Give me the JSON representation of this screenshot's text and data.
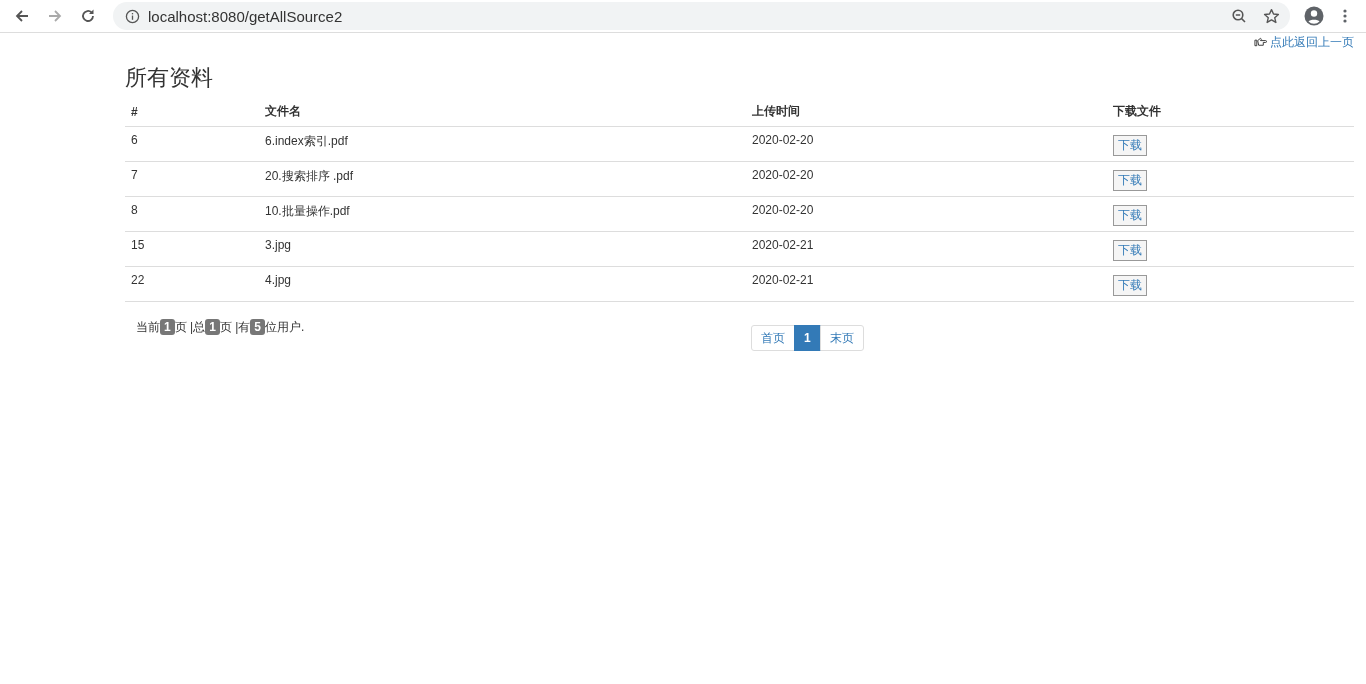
{
  "browser": {
    "back_disabled": false,
    "forward_disabled": true,
    "url": "localhost:8080/getAllSource2"
  },
  "back_link": "点此返回上一页",
  "title": "所有资料",
  "table": {
    "columns": [
      "#",
      "文件名",
      "上传时间",
      "下载文件"
    ],
    "rows": [
      {
        "id": "6",
        "name": "6.index索引.pdf",
        "time": "2020-02-20",
        "action": "下载"
      },
      {
        "id": "7",
        "name": "20.搜索排序 .pdf",
        "time": "2020-02-20",
        "action": "下载"
      },
      {
        "id": "8",
        "name": "10.批量操作.pdf",
        "time": "2020-02-20",
        "action": "下载"
      },
      {
        "id": "15",
        "name": "3.jpg",
        "time": "2020-02-21",
        "action": "下载"
      },
      {
        "id": "22",
        "name": "4.jpg",
        "time": "2020-02-21",
        "action": "下载"
      }
    ]
  },
  "status": [
    {
      "kind": "text",
      "text": "当前"
    },
    {
      "kind": "badge",
      "text": "1"
    },
    {
      "kind": "text",
      "text": "页 |总"
    },
    {
      "kind": "badge",
      "text": "1"
    },
    {
      "kind": "text",
      "text": "页 |有"
    },
    {
      "kind": "badge",
      "text": "5"
    },
    {
      "kind": "text",
      "text": "位用户."
    }
  ],
  "pagination": [
    {
      "label": "首页",
      "selected": false
    },
    {
      "label": "1",
      "selected": true
    },
    {
      "label": "末页",
      "selected": false
    }
  ]
}
